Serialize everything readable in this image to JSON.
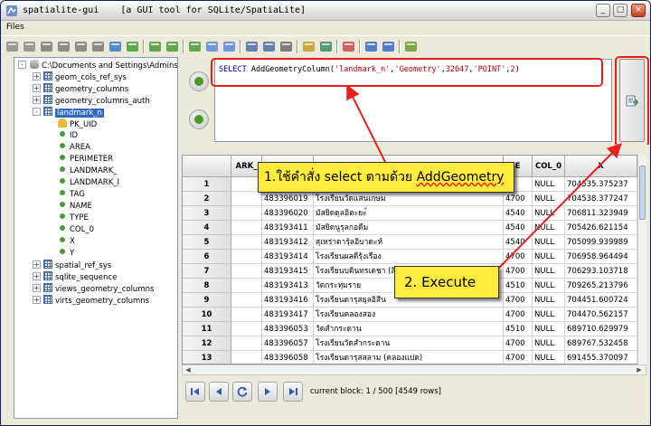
{
  "window": {
    "title": "spatialite-gui    [a GUI tool for SQLite/SpatiaLite]",
    "controls": [
      "_",
      "□",
      "×"
    ]
  },
  "menu": {
    "files": "Files"
  },
  "toolbar": {
    "icons": [
      "connect-icon",
      "disconnect-icon",
      "create-db-icon",
      "memory-db-icon",
      "memory-db-save-icon",
      "memory-db-load-icon",
      "vacuum-icon",
      "sql-script-icon",
      "load-shp-icon",
      "virtual-shp-icon",
      "virtual-csv-icon",
      "load-txt-icon",
      "load-dbf-icon",
      "dump-shp-icon",
      "dump-txt-icon",
      "srid-icon",
      "charset-icon",
      "attach-icon",
      "sql-log-icon",
      "help-icon",
      "about-icon",
      "exit-icon"
    ]
  },
  "tree": {
    "root": "C:\\Documents and Settings\\Admins",
    "tables_before": [
      "geom_cols_ref_sys",
      "geometry_columns",
      "geometry_columns_auth"
    ],
    "selected": "landmark_n",
    "columns": [
      "PK_UID",
      "ID",
      "AREA",
      "PERIMETER",
      "LANDMARK_",
      "LANDMARK_I",
      "TAG",
      "NAME",
      "TYPE",
      "COL_0",
      "X",
      "Y"
    ],
    "tables_after": [
      "spatial_ref_sys",
      "sqlite_sequence",
      "views_geometry_columns",
      "virts_geometry_columns"
    ]
  },
  "sql": {
    "kw": "SELECT",
    "fn": " AddGeometryColumn(",
    "arg1": "'landmark_n'",
    "c1": ",",
    "arg2": "'Geometry'",
    "c2": ",",
    "arg3": "32647",
    "c3": ",",
    "arg4": "'POINT'",
    "c4": ",",
    "arg5": "2",
    "close": ")"
  },
  "grid": {
    "headers": [
      "ARK_",
      "",
      "E",
      "COL_0",
      "X"
    ],
    "rows": [
      {
        "n": "1",
        "a": "",
        "b": "",
        "c": "",
        "d": "NULL",
        "x": "704535.375237"
      },
      {
        "n": "2",
        "a": "483396019",
        "b": "โรงเรียนวัดแสนเกษม",
        "c": "4700",
        "d": "NULL",
        "x": "704538.377247"
      },
      {
        "n": "3",
        "a": "483396020",
        "b": "มัสยิดดุลอิตะยะ์",
        "c": "4540",
        "d": "NULL",
        "x": "706811.323949"
      },
      {
        "n": "4",
        "a": "483193411",
        "b": "มัสยิดนูรุลกอดีม",
        "c": "4540",
        "d": "NULL",
        "x": "705426.621154"
      },
      {
        "n": "5",
        "a": "483193412",
        "b": "สุเหร่าดารุ้ลอิบาดะห์",
        "c": "4540",
        "d": "NULL",
        "x": "705099.939989"
      },
      {
        "n": "6",
        "a": "483193414",
        "b": "โรงเรียนผลดีรุ้งเรือง",
        "c": "4700",
        "d": "NULL",
        "x": "706958.964494"
      },
      {
        "n": "7",
        "a": "483193415",
        "b": "โรงเรียนบดินทรเดชา (สิงห์ สิงหเสนี)",
        "c": "4700",
        "d": "NULL",
        "x": "706293.103718"
      },
      {
        "n": "8",
        "a": "483193413",
        "b": "วัดกระทุ่มราย",
        "c": "4510",
        "d": "NULL",
        "x": "709265.213796"
      },
      {
        "n": "9",
        "a": "483193416",
        "b": "โรงเรียนดารุสยุลอิสีน",
        "c": "4700",
        "d": "NULL",
        "x": "704451.600724"
      },
      {
        "n": "10",
        "a": "483193417",
        "b": "โรงเรียนคลองสอง",
        "c": "4700",
        "d": "NULL",
        "x": "704470.562157"
      },
      {
        "n": "11",
        "a": "483396053",
        "b": "วัดสำกระดาน",
        "c": "4510",
        "d": "NULL",
        "x": "689710.629979"
      },
      {
        "n": "12",
        "a": "483396057",
        "b": "โรงเรียนวัดสำกระดาน",
        "c": "4700",
        "d": "NULL",
        "x": "689767.532458"
      },
      {
        "n": "13",
        "a": "483396058",
        "b": "โรงเรียนดารุสสลาม (คลองแปด)",
        "c": "4700",
        "d": "NULL",
        "x": "691455.370097"
      }
    ]
  },
  "pager": {
    "info": "current block: 1 / 500 [4549 rows]"
  },
  "annotations": {
    "callout1_a": "1.ใช้คำสั่ง select ตามด้วย ",
    "callout1_b": "AddGeometry",
    "callout2": "2. Execute",
    "color": "#e8201b"
  }
}
